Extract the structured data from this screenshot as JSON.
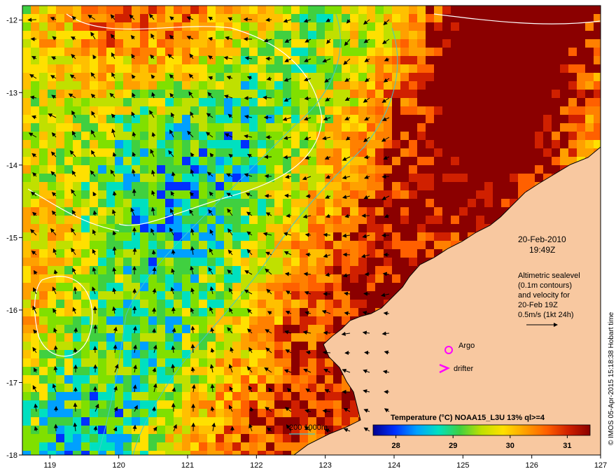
{
  "map": {
    "lon_range": [
      118.6,
      127.0
    ],
    "lat_range": [
      -18.0,
      -11.8
    ],
    "x_ticks": [
      "119",
      "120",
      "121",
      "122",
      "123",
      "124",
      "125",
      "126",
      "127"
    ],
    "y_ticks": [
      "-12",
      "-13",
      "-14",
      "-15",
      "-16",
      "-17",
      "-18"
    ]
  },
  "overlay": {
    "date": "20-Feb-2010",
    "time": "19:49Z",
    "altimetry_lines": [
      "Altimetric sealevel",
      "(0.1m contours)",
      "and velocity for",
      "20-Feb 19Z",
      "0.5m/s (1kt 24h)"
    ]
  },
  "legend": {
    "argo_label": "Argo",
    "drifter_label": "drifter",
    "depth_label": "200  1000m",
    "argo_color": "#ff00ff",
    "drifter_color": "#ff00ff",
    "depth_color": "#40c8d0"
  },
  "colorbar": {
    "title": "Temperature (°C) NOAA15_L3U 13% ql>=4",
    "ticks": [
      "28",
      "29",
      "30",
      "31"
    ],
    "range": [
      27.6,
      31.4
    ],
    "colors": [
      "#000090",
      "#0030ff",
      "#00a0ff",
      "#00e0c0",
      "#40d040",
      "#c0e000",
      "#ffe000",
      "#ffa000",
      "#ff6000",
      "#d02000",
      "#8b0000"
    ]
  },
  "credit": "© IMOS 05-Apr-2015 15:18:38 Hobart time",
  "colors": {
    "land": "#f8c8a0",
    "current_arrow": "#000000",
    "sealevel_contour": "#ffffff",
    "bathymetry": "#40c8d0"
  }
}
